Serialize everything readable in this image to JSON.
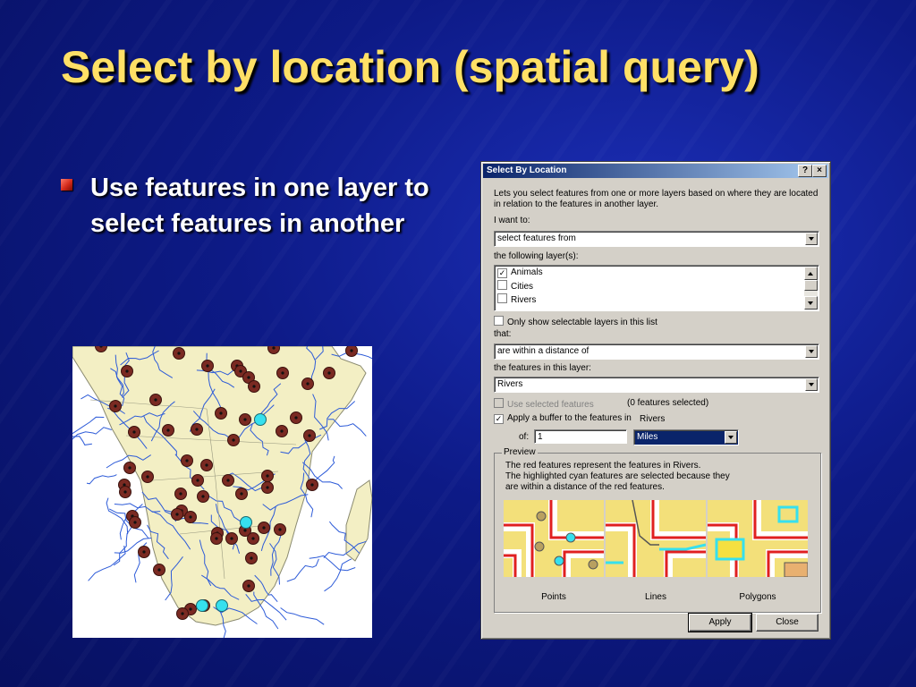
{
  "slide": {
    "title": "Select by location (spatial query)",
    "bullet": "Use features in one layer to select features in another"
  },
  "map": {
    "description_icon": "africa-map",
    "land_color": "#f3efc4",
    "river_color": "#2d5bd8",
    "point_color": "#7a2a22",
    "selected_point_color": "#36e0ee"
  },
  "dialog": {
    "title": "Select By Location",
    "help_button": "?",
    "close_button": "×",
    "description": "Lets you select features from one or more layers based on where they are located in relation to the features in another layer.",
    "i_want_to_label": "I want to:",
    "i_want_to_value": "select features from",
    "layers_label": "the following layer(s):",
    "layers": [
      {
        "name": "Animals",
        "checked": true
      },
      {
        "name": "Cities",
        "checked": false
      },
      {
        "name": "Rivers",
        "checked": false
      }
    ],
    "only_selectable_label": "Only show selectable layers in this list",
    "that_label": "that:",
    "that_value": "are within a distance of",
    "features_layer_label": "the features in this layer:",
    "features_layer_value": "Rivers",
    "use_selected_label": "Use selected features",
    "features_selected_text": "(0 features selected)",
    "apply_buffer_label": "Apply a buffer to the features in",
    "buffer_layer": "Rivers",
    "of_label": "of:",
    "buffer_distance": "1",
    "buffer_units": "Miles",
    "preview": {
      "title": "Preview",
      "line1": "The red features represent the features in Rivers.",
      "line2": "The highlighted cyan features are selected because they",
      "line3": "are within a distance of the red features.",
      "labels": [
        "Points",
        "Lines",
        "Polygons"
      ]
    },
    "apply_button": "Apply",
    "close_label": "Close"
  }
}
